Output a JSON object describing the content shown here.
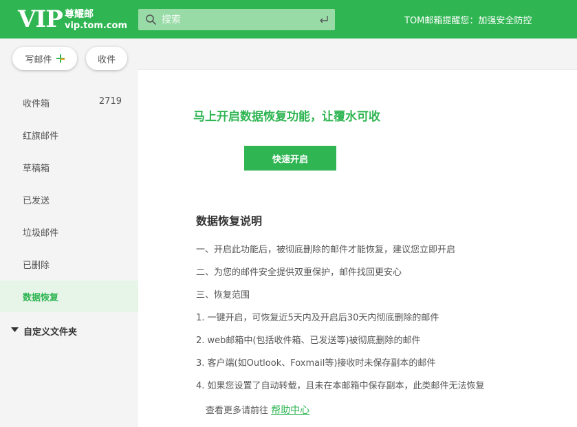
{
  "header": {
    "logo_vip": "VIP",
    "logo_cn": "尊耀邮",
    "logo_domain": "vip.tom.com",
    "search_placeholder": "搜索",
    "notice": "TOM邮箱提醒您：加强安全防控"
  },
  "sidebar": {
    "compose_label": "写邮件",
    "receive_label": "收件",
    "items": [
      {
        "label": "收件箱",
        "count": "2719"
      },
      {
        "label": "红旗邮件"
      },
      {
        "label": "草稿箱"
      },
      {
        "label": "已发送"
      },
      {
        "label": "垃圾邮件"
      },
      {
        "label": "已删除"
      },
      {
        "label": "数据恢复",
        "active": true
      }
    ],
    "custom_folders_label": "自定义文件夹"
  },
  "main": {
    "headline": "马上开启数据恢复功能，让覆水可收",
    "enable_button": "快速开启",
    "section_title": "数据恢复说明",
    "lines": [
      "一、开启此功能后，被彻底删除的邮件才能恢复，建议您立即开启",
      "二、为您的邮件安全提供双重保护，邮件找回更安心",
      "三、恢复范围",
      "1. 一键开启，可恢复近5天内及开启后30天内彻底删除的邮件",
      "2. web邮箱中(包括收件箱、已发送等)被彻底删除的邮件",
      "3. 客户端(如Outlook、Foxmail等)接收时未保存副本的邮件",
      "4. 如果您设置了自动转载，且未在本邮箱中保存副本，此类邮件无法恢复"
    ],
    "help_prefix": "查看更多请前往",
    "help_link": "帮助中心"
  },
  "colors": {
    "brand_green": "#2fb552",
    "search_bg": "#98dba6",
    "sidebar_bg": "#f4f4f4",
    "active_item_bg": "#e7f4e8",
    "plus_green": "#2fb552",
    "plus_orange": "#f5a623"
  },
  "icons": {
    "search": "search-icon",
    "enter": "enter-icon",
    "plus": "plus-icon",
    "caret": "caret-down-icon"
  }
}
